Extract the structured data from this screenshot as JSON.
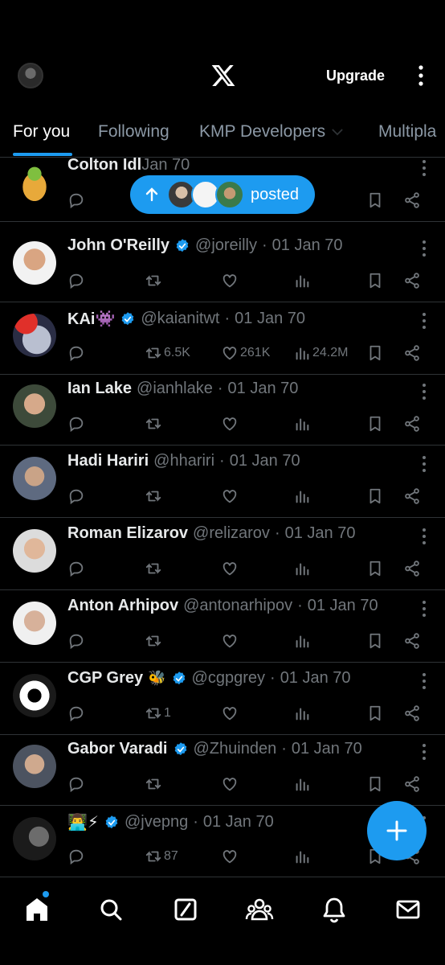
{
  "header": {
    "upgrade_label": "Upgrade",
    "logo_icon": "x-logo-icon",
    "menu_icon": "more-vertical-icon"
  },
  "tabs": [
    {
      "label": "For you",
      "active": true
    },
    {
      "label": "Following",
      "active": false
    },
    {
      "label": "KMP Developers",
      "active": false
    },
    {
      "label": "Multipla",
      "active": false
    }
  ],
  "new_posts_pill": {
    "label": "posted"
  },
  "posts": [
    {
      "name": "Colton Idl",
      "handle": "",
      "date": "Jan 70",
      "verified": false,
      "emoji": "",
      "retweets": "",
      "likes": "",
      "views": ""
    },
    {
      "name": "John O'Reilly",
      "handle": "@joreilly",
      "date": "01 Jan 70",
      "verified": true,
      "emoji": "",
      "retweets": "",
      "likes": "",
      "views": ""
    },
    {
      "name": "KAi👾",
      "handle": "@kaianitwt",
      "date": "01 Jan 70",
      "verified": true,
      "emoji": "",
      "retweets": "6.5K",
      "likes": "261K",
      "views": "24.2M"
    },
    {
      "name": "Ian Lake",
      "handle": "@ianhlake",
      "date": "01 Jan 70",
      "verified": false,
      "emoji": "",
      "retweets": "",
      "likes": "",
      "views": ""
    },
    {
      "name": "Hadi Hariri",
      "handle": "@hhariri",
      "date": "01 Jan 70",
      "verified": false,
      "emoji": "",
      "retweets": "",
      "likes": "",
      "views": ""
    },
    {
      "name": "Roman Elizarov",
      "handle": "@relizarov",
      "date": "01 Jan 70",
      "verified": false,
      "emoji": "",
      "retweets": "",
      "likes": "",
      "views": ""
    },
    {
      "name": "Anton Arhipov",
      "handle": "@antonarhipov",
      "date": "01 Jan 70",
      "verified": false,
      "emoji": "",
      "retweets": "",
      "likes": "",
      "views": ""
    },
    {
      "name": "CGP Grey",
      "handle": "@cgpgrey",
      "date": "01 Jan 70",
      "verified": true,
      "emoji": "🐝",
      "retweets": "1",
      "likes": "",
      "views": ""
    },
    {
      "name": "Gabor Varadi",
      "handle": "@Zhuinden",
      "date": "01 Jan 70",
      "verified": true,
      "emoji": "",
      "retweets": "",
      "likes": "",
      "views": ""
    },
    {
      "name": "👨‍💻⚡",
      "handle": "@jvepng",
      "date": "01 Jan 70",
      "verified": true,
      "emoji": "",
      "retweets": "87",
      "likes": "",
      "views": ""
    }
  ],
  "colors": {
    "accent": "#1d9bf0",
    "background": "#000000",
    "muted": "#71767b",
    "divider": "#2f3336"
  },
  "bottom_nav": [
    "home-icon",
    "search-icon",
    "grok-icon",
    "communities-icon",
    "notifications-icon",
    "messages-icon"
  ]
}
